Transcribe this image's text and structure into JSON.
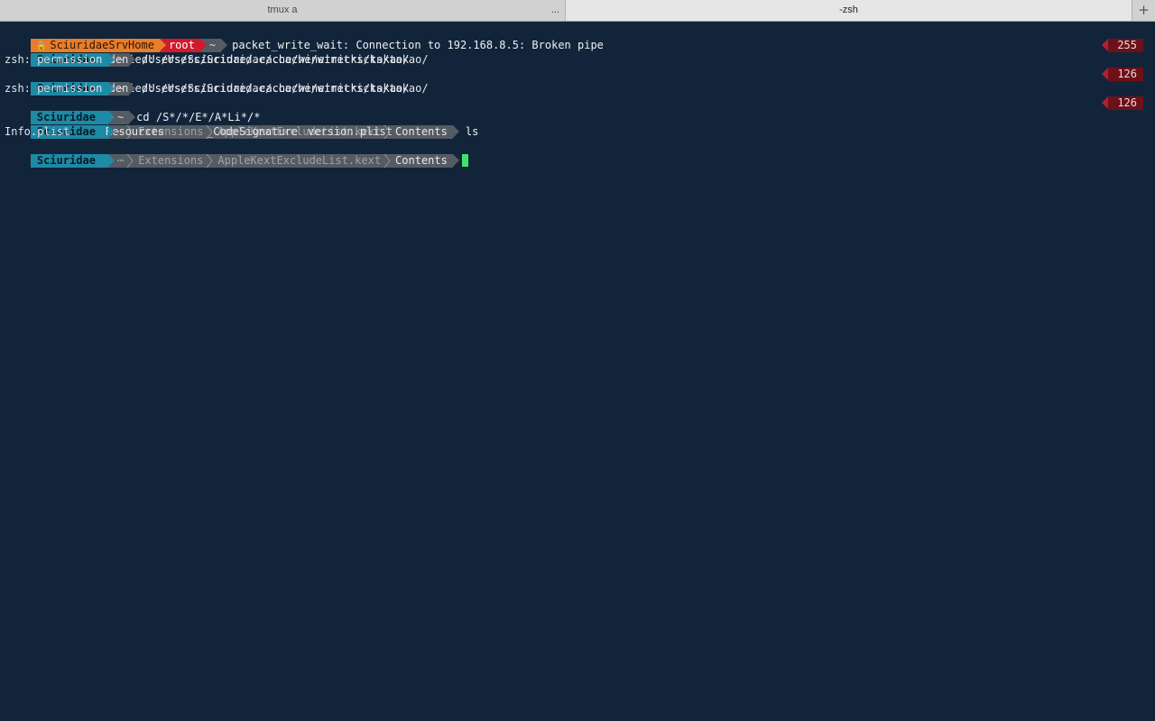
{
  "tabs": [
    {
      "title": "tmux a",
      "more": "..."
    },
    {
      "title": "-zsh"
    }
  ],
  "new_tab": "+",
  "lines": {
    "l1": {
      "host": "SciuridaeSrvHome",
      "user": "root",
      "dir": "~",
      "output": "packet_write_wait: Connection to 192.168.8.5: Broken pipe"
    },
    "l2": {
      "user": "Sciuridae",
      "dir": "~",
      "command": "/Users/Sciuridae/.cache/winetricks/takao/",
      "status": "255"
    },
    "l3": {
      "output": "zsh: permission denied: /Users/Sciuridae/.cache/winetricks/takao/"
    },
    "l4": {
      "user": "Sciuridae",
      "dir": "~",
      "command": "/Users/Sciuridae/.cache/winetricks/takao/",
      "status": "126"
    },
    "l5": {
      "output": "zsh: permission denied: /Users/Sciuridae/.cache/winetricks/takao/"
    },
    "l6": {
      "user": "Sciuridae",
      "dir": "~",
      "command": "cd /S*/*/E*/A*Li*/*",
      "status": "126"
    },
    "l7": {
      "user": "Sciuridae",
      "ellipsis": "⋯",
      "path1": "Extensions",
      "path2": "AppleKextExcludeList.kext",
      "path3": "Contents",
      "command": "ls"
    },
    "l8": {
      "files": [
        "Info.plist",
        "Resources",
        "_CodeSignature",
        "version.plist"
      ]
    },
    "l9": {
      "user": "Sciuridae",
      "ellipsis": "⋯",
      "path1": "Extensions",
      "path2": "AppleKextExcludeList.kext",
      "path3": "Contents"
    }
  },
  "colors": {
    "background": "#11243a",
    "host_segment": "#e87d2b",
    "root_segment": "#d21a2d",
    "user_segment": "#1d8aa6",
    "dir_segment": "#555b62",
    "status_segment": "#6e1017",
    "cursor": "#3ee36a"
  },
  "icons": {
    "lock": "lock-icon",
    "new_tab": "plus-icon"
  }
}
